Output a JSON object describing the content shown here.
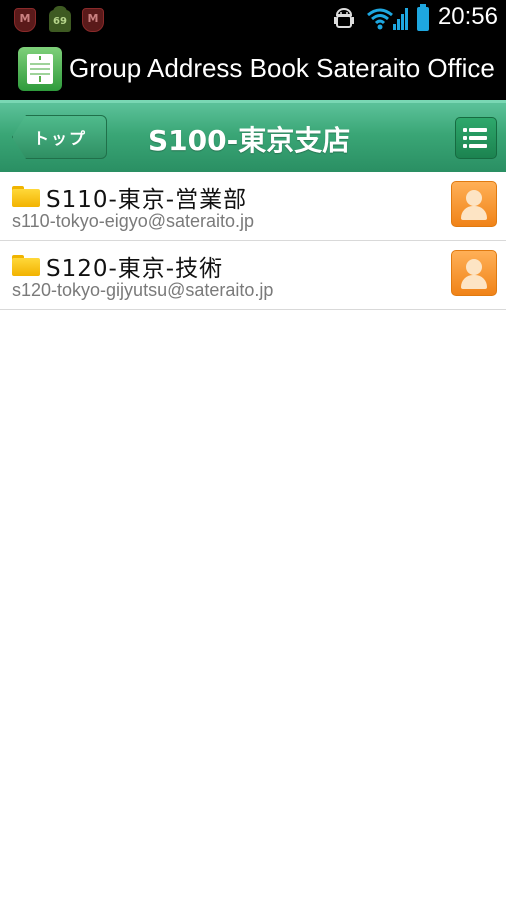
{
  "status_bar": {
    "time": "20:56",
    "notification_badge": "69",
    "icons": [
      "mcafee-icon",
      "android-update-icon",
      "mcafee-icon",
      "android-debug-icon",
      "wifi-icon",
      "signal-icon",
      "battery-icon"
    ]
  },
  "app": {
    "title": "Group Address Book Sateraito Office"
  },
  "nav": {
    "back_label": "トップ",
    "title": "S100-東京支店",
    "menu_icon": "list-menu-icon"
  },
  "items": [
    {
      "name": "S110-東京-営業部",
      "email": "s110-tokyo-eigyo@sateraito.jp",
      "icon": "folder-icon",
      "action_icon": "contact-icon"
    },
    {
      "name": "S120-東京-技術",
      "email": "s120-tokyo-gijyutsu@sateraito.jp",
      "icon": "folder-icon",
      "action_icon": "contact-icon"
    }
  ],
  "colors": {
    "header_green": "#3aa676",
    "contact_orange": "#f08318",
    "folder_yellow": "#ffd83a"
  }
}
